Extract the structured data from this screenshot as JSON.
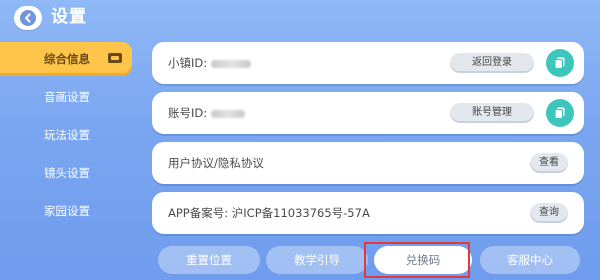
{
  "header": {
    "title": "设置"
  },
  "sidebar": {
    "items": [
      {
        "label": "综合信息",
        "active": true
      },
      {
        "label": "音画设置"
      },
      {
        "label": "玩法设置"
      },
      {
        "label": "镜头设置"
      },
      {
        "label": "家园设置"
      }
    ]
  },
  "rows": [
    {
      "label": "小镇ID:",
      "button": "返回登录"
    },
    {
      "label": "账号ID:",
      "button": "账号管理"
    },
    {
      "label": "用户协议/隐私协议",
      "button": "查看"
    },
    {
      "label": "APP备案号: 沪ICP备11033765号-57A",
      "button": "查询"
    }
  ],
  "bottom": {
    "buttons": [
      "重置位置",
      "教学引导",
      "兑换码",
      "客服中心"
    ]
  },
  "colors": {
    "accent": "#ffc54a",
    "copy": "#3dc6bc",
    "highlight_box": "#e03b3b"
  }
}
